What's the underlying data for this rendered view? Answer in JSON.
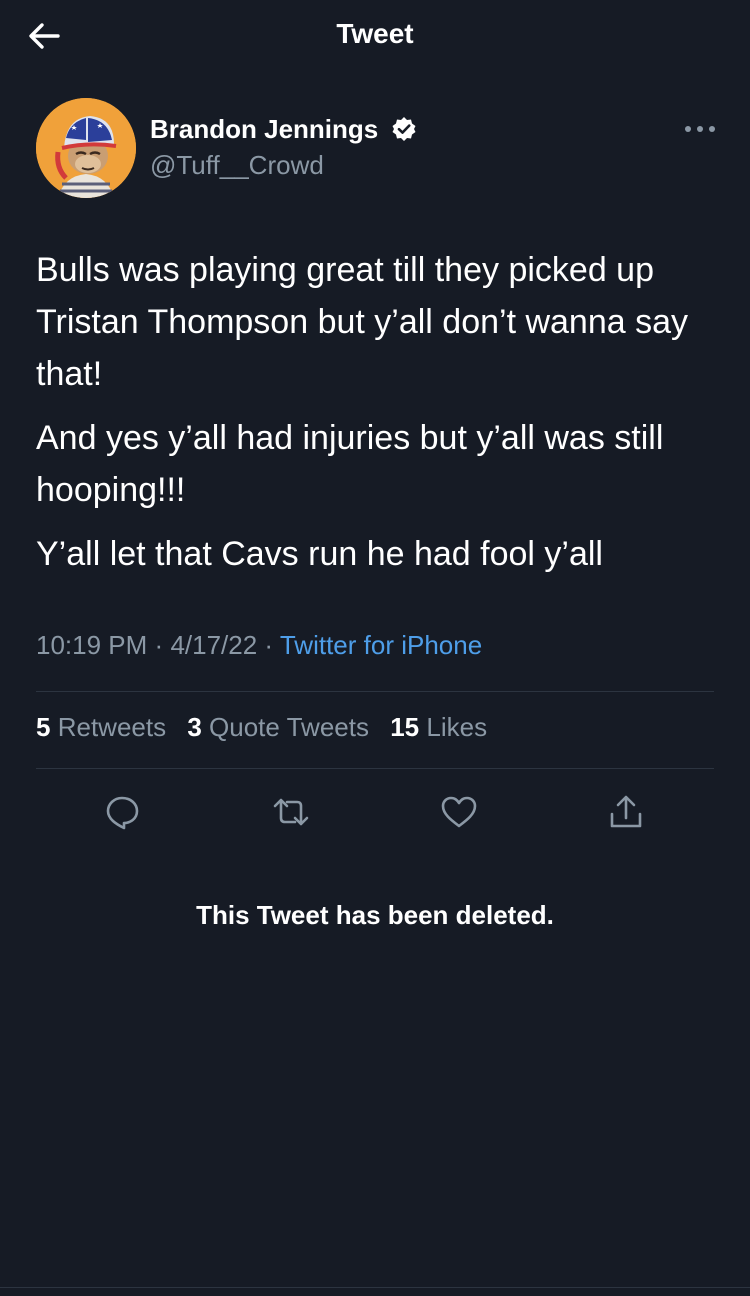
{
  "header": {
    "title": "Tweet",
    "back_icon": "arrow-left-icon"
  },
  "author": {
    "name": "Brandon Jennings",
    "handle": "@Tuff__Crowd",
    "verified_icon": "verified-badge-icon",
    "avatar": "avatar",
    "more_icon": "more-horizontal-icon"
  },
  "tweet": {
    "paragraphs": [
      "Bulls was playing great till they picked up Tristan Thompson but y’all don’t wanna say that!",
      "And yes y’all had injuries but y’all was still hooping!!!",
      "Y’all let that Cavs run he had fool y’all"
    ],
    "time": "10:19 PM",
    "separator": "·",
    "date": "4/17/22",
    "source": "Twitter for iPhone"
  },
  "stats": {
    "retweets_count": "5",
    "retweets_label": "Retweets",
    "quotes_count": "3",
    "quotes_label": "Quote Tweets",
    "likes_count": "15",
    "likes_label": "Likes"
  },
  "actions": [
    "reply-icon",
    "retweet-icon",
    "like-icon",
    "share-icon"
  ],
  "notice": {
    "deleted_text": "This Tweet has been deleted."
  },
  "colors": {
    "background": "#161b25",
    "text": "#ffffff",
    "secondary_text": "#8b98a5",
    "link": "#4e9ee9",
    "divider": "#2c3440",
    "avatar_bg": "#f0a13a"
  }
}
